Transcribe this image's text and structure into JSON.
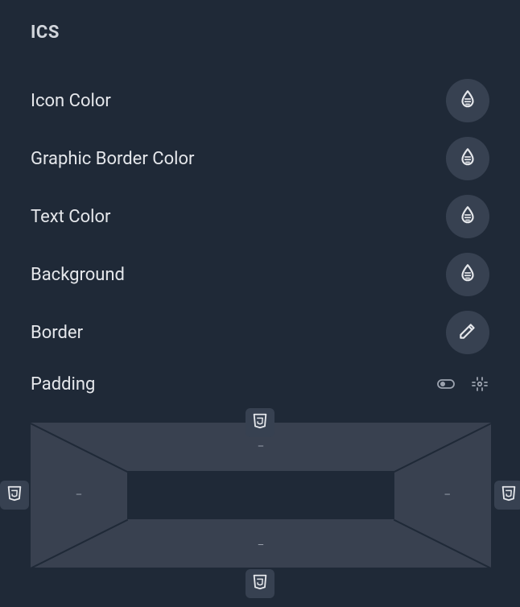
{
  "section": {
    "title": "ICS"
  },
  "rows": {
    "icon_color": {
      "label": "Icon Color"
    },
    "graphic_border_color": {
      "label": "Graphic Border Color"
    },
    "text_color": {
      "label": "Text Color"
    },
    "background": {
      "label": "Background"
    },
    "border": {
      "label": "Border"
    },
    "padding": {
      "label": "Padding",
      "values": {
        "top": "–",
        "right": "–",
        "bottom": "–",
        "left": "–"
      }
    }
  }
}
